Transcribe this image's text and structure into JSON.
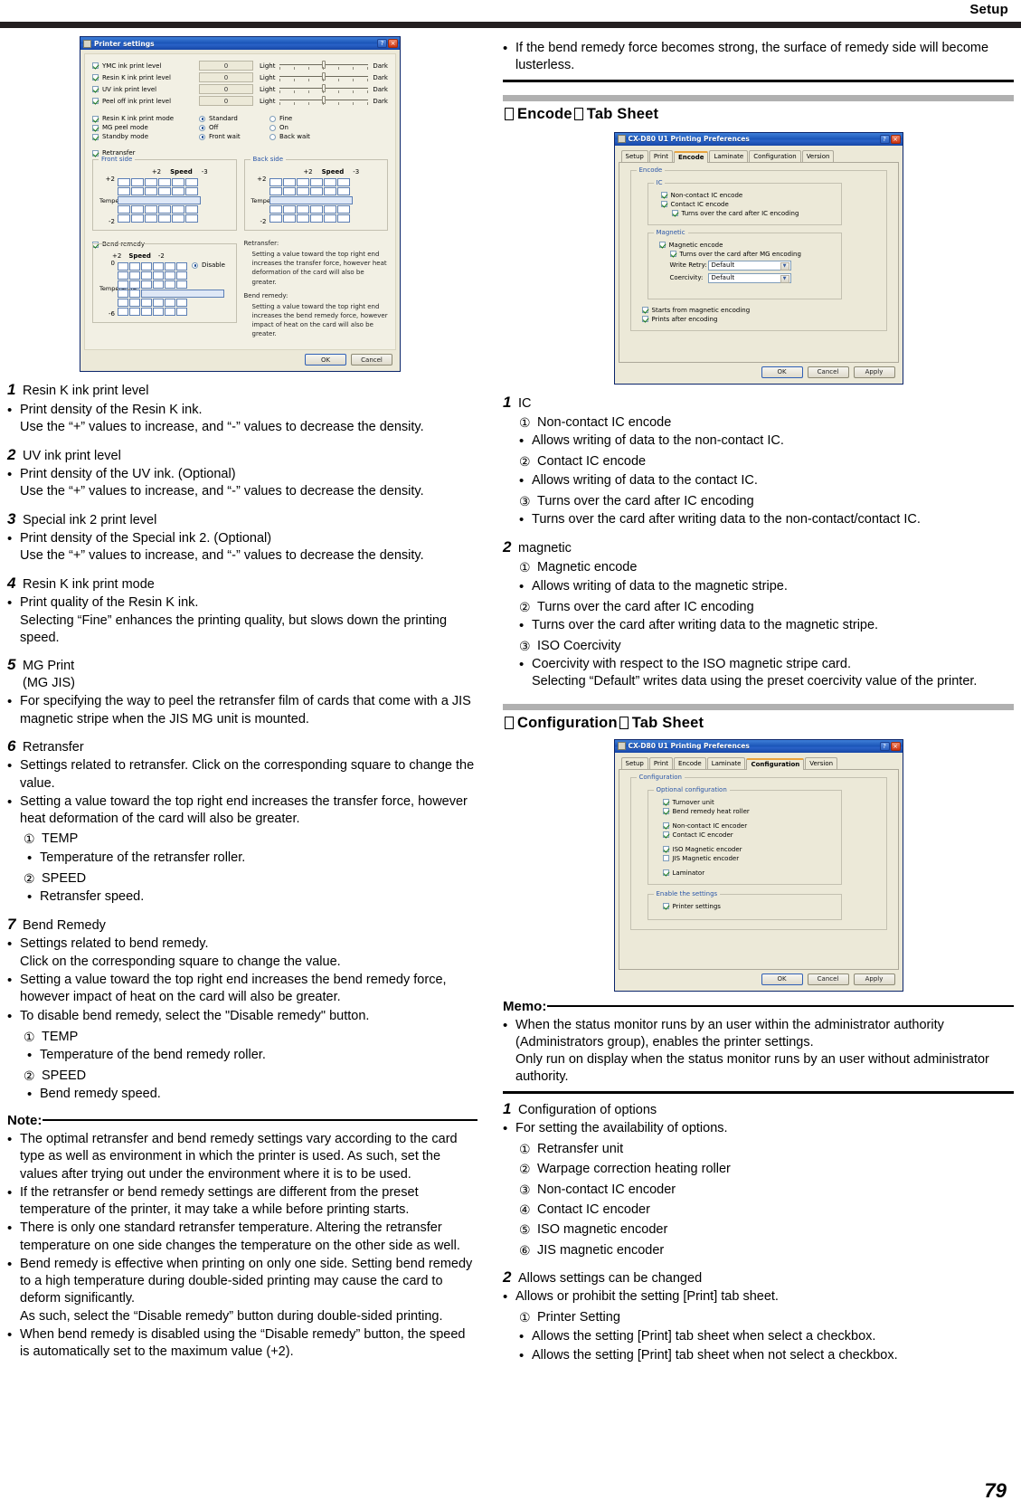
{
  "header": {
    "title": "Setup",
    "page_number": "79"
  },
  "printer_settings_dialog": {
    "title": "Printer settings",
    "help_button": "?",
    "close_button": "×",
    "levels": [
      {
        "label": "YMC ink print level",
        "value": "0",
        "left": "Light",
        "right": "Dark",
        "checked": true
      },
      {
        "label": "Resin K ink print level",
        "value": "0",
        "left": "Light",
        "right": "Dark",
        "checked": true
      },
      {
        "label": "UV ink print level",
        "value": "0",
        "left": "Light",
        "right": "Dark",
        "checked": true
      },
      {
        "label": "Peel off ink print level",
        "value": "0",
        "left": "Light",
        "right": "Dark",
        "checked": true
      }
    ],
    "modes": [
      {
        "label": "Resin K ink print mode",
        "opt1": "Standard",
        "opt2": "Fine",
        "checked": true,
        "selected": 1
      },
      {
        "label": "MG peel mode",
        "opt1": "Off",
        "opt2": "On",
        "checked": true,
        "selected": 1
      },
      {
        "label": "Standby mode",
        "opt1": "Front wait",
        "opt2": "Back wait",
        "checked": true,
        "selected": 1
      }
    ],
    "retransfer_checkbox": "Retransfer",
    "front_side": {
      "caption": "Front side",
      "speed_label": "Speed",
      "speed_max": "+2",
      "speed_min": "-3",
      "temp_label": "Temperature",
      "temp_max": "+2",
      "temp_min": "-2"
    },
    "back_side": {
      "caption": "Back side",
      "speed_label": "Speed",
      "speed_max": "+2",
      "speed_min": "-3",
      "temp_label": "Temperature",
      "temp_max": "+2",
      "temp_min": "-2"
    },
    "bend_remedy": {
      "caption": "Bend remedy",
      "speed_label": "Speed",
      "speed_max": "+2",
      "speed_min": "-2",
      "temp_label": "Temperature",
      "temp_max": "0",
      "temp_min": "-6",
      "disable_label": "Disable"
    },
    "retransfer_note": {
      "title1": "Retransfer:",
      "body1": "Setting a value toward the top right end increases the transfer force, however heat deformation of the card will also be greater.",
      "title2": "Bend remedy:",
      "body2": "Setting a value toward the top right end increases the bend remedy force, however impact of heat on the card will also be greater."
    },
    "ok_button": "OK",
    "cancel_button": "Cancel"
  },
  "left_column": {
    "items": [
      {
        "n": "1",
        "title": "Resin K ink print level",
        "bullets": [
          {
            "lines": [
              "Print density of the Resin K ink.",
              "Use the “+” values to increase, and “-” values to decrease the density."
            ]
          }
        ]
      },
      {
        "n": "2",
        "title": "UV ink print level",
        "bullets": [
          {
            "lines": [
              "Print density of the UV ink. (Optional)",
              "Use the “+” values to increase, and “-” values to decrease the density."
            ]
          }
        ]
      },
      {
        "n": "3",
        "title": "Special ink 2 print level",
        "bullets": [
          {
            "lines": [
              "Print density of the Special ink 2. (Optional)",
              "Use the “+” values to increase, and “-” values to decrease the density."
            ]
          }
        ]
      },
      {
        "n": "4",
        "title": "Resin K ink print mode",
        "bullets": [
          {
            "lines": [
              "Print quality of the Resin K ink.",
              "Selecting “Fine” enhances the printing quality, but slows down the printing speed."
            ]
          }
        ]
      },
      {
        "n": "5",
        "title": "MG Print",
        "title2": "(MG JIS)",
        "bullets": [
          {
            "lines": [
              "For specifying the way to peel the retransfer film of cards that come with a JIS magnetic stripe when the JIS MG unit is mounted."
            ]
          }
        ]
      }
    ],
    "retransfer": {
      "n": "6",
      "title": "Retransfer",
      "bullets": [
        {
          "lines": [
            "Settings related to retransfer. Click on the corresponding square to change the value."
          ]
        },
        {
          "lines": [
            "Setting a value toward the top right end increases the transfer force, however heat deformation of the card will also be greater."
          ]
        }
      ],
      "sub": [
        {
          "mark": "①",
          "label": "TEMP",
          "bullet": "Temperature of the retransfer roller."
        },
        {
          "mark": "②",
          "label": "SPEED",
          "bullet": "Retransfer speed."
        }
      ]
    },
    "bend_remedy": {
      "n": "7",
      "title": "Bend Remedy",
      "bullets": [
        {
          "lines": [
            "Settings related to bend remedy.",
            "Click on the corresponding square to change the value."
          ]
        },
        {
          "lines": [
            "Setting a value toward the top right end increases the bend remedy force, however impact of heat on the card will also be greater."
          ]
        },
        {
          "lines": [
            "To disable bend remedy, select the \"Disable remedy\" button."
          ]
        }
      ],
      "sub": [
        {
          "mark": "①",
          "label": "TEMP",
          "bullet": "Temperature of the bend remedy roller."
        },
        {
          "mark": "②",
          "label": "SPEED",
          "bullet": "Bend remedy speed."
        }
      ]
    },
    "note": {
      "label": "Note:",
      "bullets": [
        {
          "lines": [
            "The optimal retransfer and bend remedy settings vary according to the card type as well as environment in which the printer is used. As such, set the values after trying out under the environment where it is to be used."
          ]
        },
        {
          "lines": [
            "If the retransfer or bend remedy settings are different from the preset temperature of the printer, it may take a while before printing starts."
          ]
        },
        {
          "lines": [
            "There is only one standard retransfer temperature. Altering the retransfer temperature on one side changes the temperature on the other side as well."
          ]
        },
        {
          "lines": [
            "Bend remedy is effective when printing on only one side. Setting bend remedy to a high temperature during double-sided printing may cause the card to deform significantly.",
            "As such, select the “Disable remedy” button during double-sided printing."
          ]
        },
        {
          "lines": [
            "When bend remedy is disabled using the “Disable remedy” button, the speed is automatically set to the maximum value (+2)."
          ]
        }
      ]
    }
  },
  "right_column": {
    "note_top": {
      "bullets": [
        {
          "lines": [
            "If the bend remedy force becomes strong, the surface of remedy side will become lusterless."
          ]
        }
      ]
    },
    "encode_section": {
      "heading": "Encode",
      "heading_suffix": "Tab Sheet",
      "dialog": {
        "title": "CX-D80 U1 Printing Preferences",
        "help_button": "?",
        "close_button": "×",
        "tabs": [
          "Setup",
          "Print",
          "Encode",
          "Laminate",
          "Configuration",
          "Version"
        ],
        "active_tab": "Encode",
        "group_caption": "Encode",
        "ic_group": {
          "caption": "IC",
          "items": [
            {
              "label": "Non-contact IC encode",
              "checked": true,
              "indent": 0
            },
            {
              "label": "Contact IC encode",
              "checked": true,
              "indent": 0
            },
            {
              "label": "Turns over the card after IC encoding",
              "checked": true,
              "indent": 1
            }
          ]
        },
        "magnetic_group": {
          "caption": "Magnetic",
          "items": [
            {
              "label": "Magnetic encode",
              "checked": true,
              "indent": 0
            },
            {
              "label": "Turns over the card after MG encoding",
              "checked": true,
              "indent": 1
            }
          ],
          "selects": [
            {
              "label": "Write Retry:",
              "value": "Default"
            },
            {
              "label": "Coercivity:",
              "value": "Default"
            }
          ]
        },
        "bottom_items": [
          {
            "label": "Starts from magnetic encoding",
            "checked": true
          },
          {
            "label": "Prints after encoding",
            "checked": true
          }
        ],
        "ok_button": "OK",
        "cancel_button": "Cancel",
        "apply_button": "Apply"
      },
      "items": [
        {
          "n": "1",
          "title": "IC",
          "sub": [
            {
              "mark": "①",
              "label": "Non-contact IC encode",
              "bullets": [
                "Allows writing of data to the non-contact IC."
              ]
            },
            {
              "mark": "②",
              "label": "Contact IC encode",
              "bullets": [
                "Allows writing of data to the contact IC."
              ]
            },
            {
              "mark": "③",
              "label": "Turns over the card after IC encoding",
              "bullets": [
                "Turns over the card after writing data to the non-contact/contact IC."
              ]
            }
          ]
        },
        {
          "n": "2",
          "title": "magnetic",
          "sub": [
            {
              "mark": "①",
              "label": "Magnetic encode",
              "bullets": [
                "Allows writing of data to the magnetic stripe."
              ]
            },
            {
              "mark": "②",
              "label": "Turns over the card after IC encoding",
              "bullets": [
                "Turns over the card after writing data to the magnetic stripe."
              ]
            },
            {
              "mark": "③",
              "label": "ISO Coercivity",
              "bullets": [
                "Coercivity with respect to the ISO magnetic stripe card.\nSelecting “Default” writes data using the preset coercivity value of the printer."
              ]
            }
          ]
        }
      ]
    },
    "configuration_section": {
      "heading": "Configuration",
      "heading_suffix": "Tab Sheet",
      "dialog": {
        "title": "CX-D80 U1 Printing Preferences",
        "help_button": "?",
        "close_button": "×",
        "tabs": [
          "Setup",
          "Print",
          "Encode",
          "Laminate",
          "Configuration",
          "Version"
        ],
        "active_tab": "Configuration",
        "group_caption": "Configuration",
        "optional_group": {
          "caption": "Optional configuration",
          "items": [
            {
              "label": "Turnover unit",
              "checked": true
            },
            {
              "label": "Bend remedy heat roller",
              "checked": true
            },
            {
              "label": "Non-contact IC encoder",
              "checked": true
            },
            {
              "label": "Contact IC encoder",
              "checked": true
            },
            {
              "label": "ISO Magnetic encoder",
              "checked": true
            },
            {
              "label": "JIS Magnetic encoder",
              "checked": false
            },
            {
              "label": "Laminator",
              "checked": true
            }
          ]
        },
        "enable_group": {
          "caption": "Enable the settings",
          "items": [
            {
              "label": "Printer settings",
              "checked": true
            }
          ]
        },
        "ok_button": "OK",
        "cancel_button": "Cancel",
        "apply_button": "Apply"
      },
      "memo": {
        "label": "Memo:",
        "bullets": [
          {
            "lines": [
              "When the status monitor runs by an user within the administrator authority (Administrators group), enables the printer settings.",
              "Only run on display when the status monitor runs by an user without administrator authority."
            ]
          }
        ]
      },
      "items": [
        {
          "n": "1",
          "title": "Configuration of options",
          "bullets": [
            {
              "lines": [
                "For setting the availability of options."
              ]
            }
          ],
          "circled": [
            {
              "mark": "①",
              "label": "Retransfer unit"
            },
            {
              "mark": "②",
              "label": "Warpage correction heating roller"
            },
            {
              "mark": "③",
              "label": "Non-contact IC encoder"
            },
            {
              "mark": "④",
              "label": "Contact IC encoder"
            },
            {
              "mark": "⑤",
              "label": "ISO magnetic encoder"
            },
            {
              "mark": "⑥",
              "label": "JIS magnetic encoder"
            }
          ]
        },
        {
          "n": "2",
          "title": "Allows settings can be changed",
          "bullets": [
            {
              "lines": [
                "Allows or prohibit the setting [Print] tab sheet."
              ]
            }
          ],
          "sub": [
            {
              "mark": "①",
              "label": "Printer Setting",
              "bullets": [
                "Allows the setting [Print] tab sheet when select a checkbox.",
                "Allows the setting [Print] tab sheet when not select a checkbox."
              ]
            }
          ]
        }
      ]
    }
  }
}
